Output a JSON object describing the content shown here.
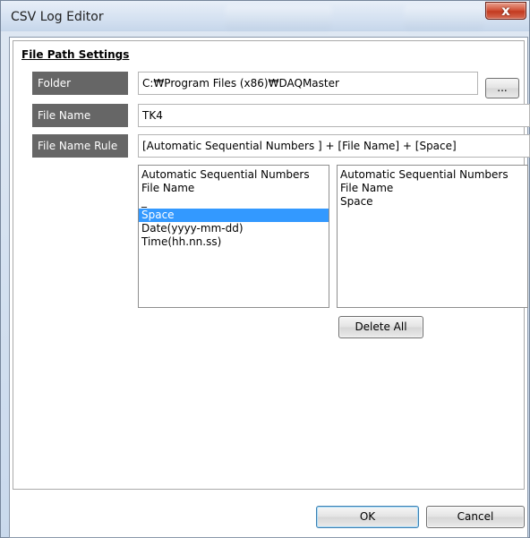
{
  "window": {
    "title": "CSV Log Editor",
    "close_glyph": "x"
  },
  "group": {
    "title": "File Path Settings"
  },
  "fields": {
    "folder": {
      "label": "Folder",
      "value": "C:₩Program Files (x86)₩DAQMaster",
      "browse_label": "..."
    },
    "file_name": {
      "label": "File Name",
      "value": "TK4"
    },
    "file_name_rule": {
      "label": "File Name Rule",
      "value": "[Automatic Sequential Numbers ] + [File Name] + [Space]"
    }
  },
  "available_list": {
    "items": [
      "Automatic Sequential Numbers",
      "File Name",
      "_",
      "Space",
      "Date(yyyy-mm-dd)",
      "Time(hh.nn.ss)"
    ],
    "selected": "Space"
  },
  "selected_list": {
    "items": [
      "Automatic Sequential Numbers",
      "File Name",
      "Space"
    ]
  },
  "buttons": {
    "delete_all": "Delete All",
    "ok": "OK",
    "cancel": "Cancel"
  },
  "colors": {
    "label_bg": "#666666",
    "selection": "#3399ff",
    "close_button": "#c33a20"
  }
}
